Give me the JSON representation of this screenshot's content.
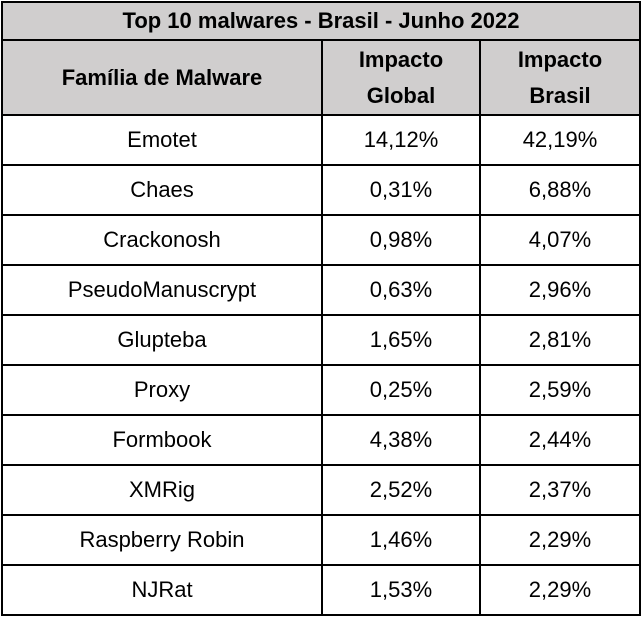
{
  "title": "Top 10 malwares - Brasil - Junho 2022",
  "headers": [
    "Família de Malware",
    "Impacto Global",
    "Impacto Brasil"
  ],
  "rows": [
    [
      "Emotet",
      "14,12%",
      "42,19%"
    ],
    [
      "Chaes",
      "0,31%",
      "6,88%"
    ],
    [
      "Crackonosh",
      "0,98%",
      "4,07%"
    ],
    [
      "PseudoManuscrypt",
      "0,63%",
      "2,96%"
    ],
    [
      "Glupteba",
      "1,65%",
      "2,81%"
    ],
    [
      "Proxy",
      "0,25%",
      "2,59%"
    ],
    [
      "Formbook",
      "4,38%",
      "2,44%"
    ],
    [
      "XMRig",
      "2,52%",
      "2,37%"
    ],
    [
      "Raspberry Robin",
      "1,46%",
      "2,29%"
    ],
    [
      "NJRat",
      "1,53%",
      "2,29%"
    ]
  ],
  "colors": {
    "header_bg": "#d0cece",
    "border": "#000000"
  }
}
